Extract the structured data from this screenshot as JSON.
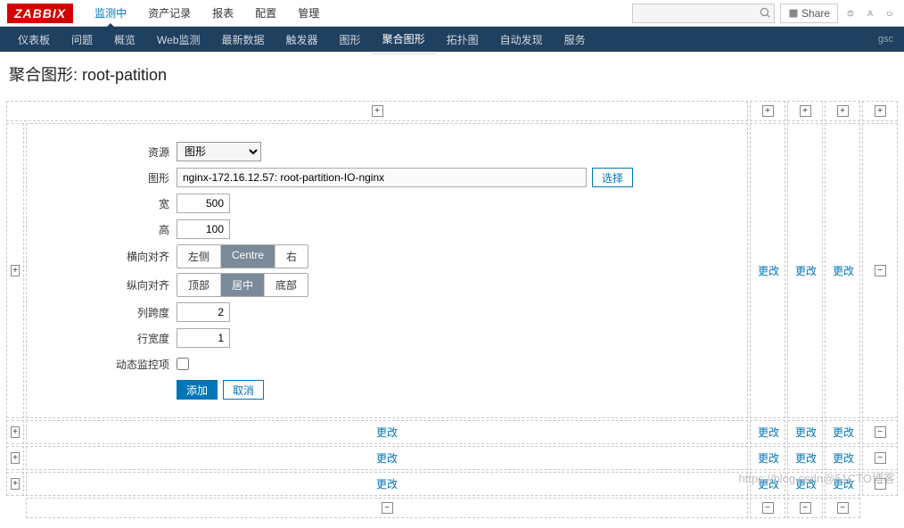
{
  "logo": "ZABBIX",
  "topnav": {
    "items": [
      "监测中",
      "资产记录",
      "报表",
      "配置",
      "管理"
    ],
    "active": 0
  },
  "search": {
    "placeholder": ""
  },
  "share_label": "Share",
  "subnav": {
    "items": [
      "仪表板",
      "问题",
      "概览",
      "Web监测",
      "最新数据",
      "触发器",
      "图形",
      "聚合图形",
      "拓扑图",
      "自动发现",
      "服务"
    ],
    "active": 7,
    "right_text": "gsc"
  },
  "page_title": "聚合图形: root-patition",
  "form": {
    "resource_label": "资源",
    "resource_options": [
      "图形"
    ],
    "graph_label": "图形",
    "graph_value": "nginx-172.16.12.57: root-partition-IO-nginx",
    "select_btn": "选择",
    "width_label": "宽",
    "width_value": "500",
    "height_label": "高",
    "height_value": "100",
    "halign_label": "横向对齐",
    "halign_opts": [
      "左侧",
      "Centre",
      "右"
    ],
    "halign_active": 1,
    "valign_label": "纵向对齐",
    "valign_opts": [
      "顶部",
      "居中",
      "底部"
    ],
    "valign_active": 1,
    "colspan_label": "列跨度",
    "colspan_value": "2",
    "rowspan_label": "行宽度",
    "rowspan_value": "1",
    "dynamic_label": "动态监控项",
    "add_btn": "添加",
    "cancel_btn": "取消"
  },
  "grid": {
    "change": "更改",
    "plus": "+",
    "minus": "−"
  },
  "watermark": "https://blog.csdn@51CTO博客"
}
